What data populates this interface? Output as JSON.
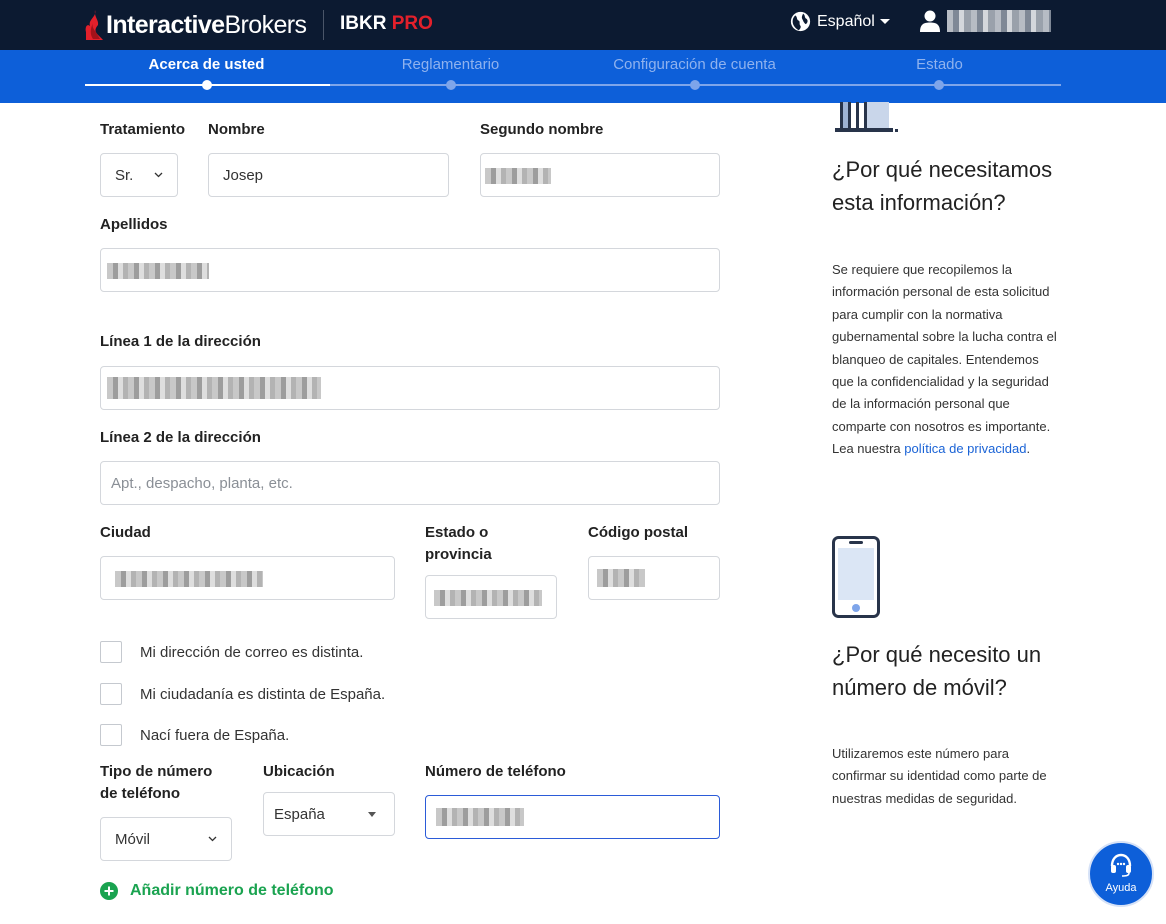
{
  "header": {
    "brand_bold": "Interactive",
    "brand_regular": "Brokers",
    "product": "IBKR",
    "product_accent": "PRO",
    "language": "Español",
    "colors": {
      "bar": "#0c1a31",
      "accent_red": "#e3202b"
    }
  },
  "stepper": {
    "steps": [
      {
        "label": "Acerca de usted",
        "active": true
      },
      {
        "label": "Reglamentario",
        "active": false
      },
      {
        "label": "Configuración de cuenta",
        "active": false
      },
      {
        "label": "Estado",
        "active": false
      }
    ],
    "color": "#0d5fd9"
  },
  "form": {
    "salutation": {
      "label": "Tratamiento",
      "value": "Sr."
    },
    "first_name": {
      "label": "Nombre",
      "value": "Josep"
    },
    "middle_name": {
      "label": "Segundo nombre"
    },
    "last_name": {
      "label": "Apellidos"
    },
    "address1": {
      "label": "Línea 1 de la dirección"
    },
    "address2": {
      "label": "Línea 2 de la dirección",
      "placeholder": "Apt., despacho, planta, etc."
    },
    "city": {
      "label": "Ciudad"
    },
    "state": {
      "label_line1": "Estado o",
      "label_line2": "provincia"
    },
    "postal": {
      "label": "Código postal"
    },
    "checkboxes": [
      {
        "label": "Mi dirección de correo es distinta.",
        "checked": false
      },
      {
        "label": "Mi ciudadanía es distinta de España.",
        "checked": false
      },
      {
        "label": "Nací fuera de España.",
        "checked": false
      }
    ],
    "phone_type": {
      "label_line1": "Tipo de número",
      "label_line2": "de teléfono",
      "value": "Móvil"
    },
    "location": {
      "label": "Ubicación",
      "value": "España"
    },
    "phone_number": {
      "label": "Número de teléfono"
    },
    "add_phone": "Añadir número de teléfono"
  },
  "sidebar": {
    "why_info": {
      "title": "¿Por qué necesitamos esta información?",
      "body": "Se requiere que recopilemos la información personal de esta solicitud para cumplir con la normativa gubernamental sobre la lucha contra el blanqueo de capitales. Entendemos que la confidencialidad y la seguridad de la información personal que comparte con nosotros es importante. Lea nuestra",
      "link": "política de privacidad",
      "after_link": "."
    },
    "why_mobile": {
      "title": "¿Por qué necesito un número de móvil?",
      "body": "Utilizaremos este número para confirmar su identidad como parte de nuestras medidas de seguridad."
    }
  },
  "help": {
    "label": "Ayuda"
  },
  "icons": [
    "flame-logo-icon",
    "globe-icon",
    "user-icon",
    "chevron-down-icon",
    "plus-circle-icon",
    "building-icon",
    "phone-icon",
    "headset-icon"
  ]
}
